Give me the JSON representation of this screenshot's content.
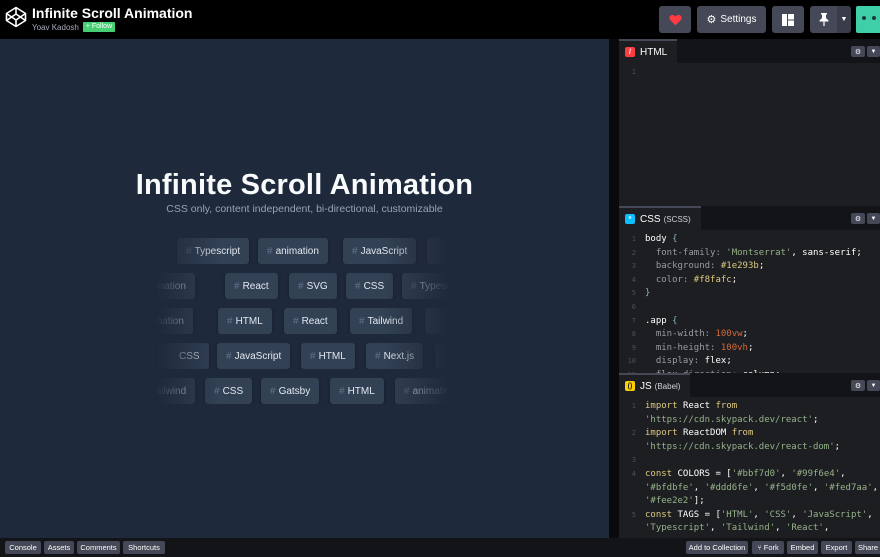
{
  "header": {
    "title": "Infinite Scroll Animation",
    "author": "Yoav Kadosh",
    "follow_label": "+ Follow",
    "settings_label": "Settings",
    "icons": [
      "codepen-logo-icon",
      "heart-icon",
      "gear-icon",
      "layout-icon",
      "pin-icon",
      "chevron-down-icon"
    ]
  },
  "preview": {
    "title": "Infinite Scroll Animation",
    "subtitle": "CSS only, content independent, bi-directional, customizable",
    "background": "#1e293b",
    "tag_background": "#334155",
    "rows": [
      [
        "Typescript",
        "animation",
        "JavaScript",
        ""
      ],
      [
        "animation",
        "React",
        "SVG",
        "CSS",
        "Typescript"
      ],
      [
        "animation",
        "HTML",
        "React",
        "Tailwind",
        ""
      ],
      [
        "CSS",
        "JavaScript",
        "HTML",
        "Next.js",
        ""
      ],
      [
        "Tailwind",
        "CSS",
        "Gatsby",
        "HTML",
        "animation"
      ]
    ]
  },
  "editors": {
    "html": {
      "label": "HTML",
      "badge_color": "#ff3c41"
    },
    "css": {
      "label": "CSS",
      "preprocessor": "(SCSS)",
      "badge_color": "#0ebeff",
      "lines": [
        "body {",
        "  font-family: 'Montserrat', sans-serif;",
        "  background: #1e293b;",
        "  color: #f8fafc;",
        "}",
        "",
        ".app {",
        "  min-width: 100vw;",
        "  min-height: 100vh;",
        "  display: flex;",
        "  flex-direction: column;"
      ]
    },
    "js": {
      "label": "JS",
      "preprocessor": "(Babel)",
      "badge_color": "#fcd000",
      "lines": [
        "import React from",
        "'https://cdn.skypack.dev/react';",
        "import ReactDOM from",
        "'https://cdn.skypack.dev/react-dom';",
        "",
        "const COLORS = ['#bbf7d0', '#99f6e4',",
        "'#bfdbfe', '#ddd6fe', '#f5d0fe', '#fed7aa',",
        "'#fee2e2'];",
        "const TAGS = ['HTML', 'CSS', 'JavaScript',",
        "'Typescript', 'Tailwind', 'React',"
      ]
    }
  },
  "footer": {
    "left": [
      "Console",
      "Assets",
      "Comments",
      "Shortcuts"
    ],
    "right": [
      "Add to Collection",
      "Fork",
      "Embed",
      "Export",
      "Share"
    ]
  }
}
